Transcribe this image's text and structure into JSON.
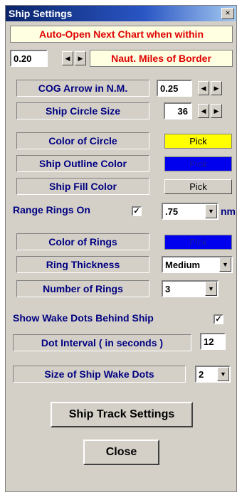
{
  "window": {
    "title": "Ship Settings",
    "close_glyph": "×"
  },
  "auto_open": {
    "label": "Auto-Open Next Chart when within",
    "value": "0.20",
    "unit_label": "Naut. Miles of Border"
  },
  "cog_arrow": {
    "label": "COG Arrow in N.M.",
    "value": "0.25"
  },
  "ship_circle_size": {
    "label": "Ship Circle Size",
    "value": "36"
  },
  "color_of_circle": {
    "label": "Color of Circle",
    "pick_label": "Pick",
    "color": "#ffff00"
  },
  "ship_outline_color": {
    "label": "Ship Outline Color",
    "pick_label": "Pick",
    "color": "#0000ee"
  },
  "ship_fill_color": {
    "label": "Ship Fill Color",
    "pick_label": "Pick",
    "color": "#d4d0c8"
  },
  "range_rings": {
    "label": "Range Rings On",
    "checked": true,
    "value": ".75",
    "unit": "nm"
  },
  "color_of_rings": {
    "label": "Color of Rings",
    "pick_label": "Pick",
    "color": "#0000ee"
  },
  "ring_thickness": {
    "label": "Ring Thickness",
    "value": "Medium"
  },
  "number_of_rings": {
    "label": "Number of Rings",
    "value": "3"
  },
  "wake_dots": {
    "label": "Show Wake Dots Behind Ship",
    "checked": true
  },
  "dot_interval": {
    "label": "Dot Interval  ( in seconds )",
    "value": "12"
  },
  "wake_dot_size": {
    "label": "Size of Ship Wake Dots",
    "value": "2"
  },
  "buttons": {
    "track_settings": "Ship Track Settings",
    "close": "Close"
  },
  "icons": {
    "spin_left": "◀",
    "spin_right": "▶",
    "dropdown": "▼",
    "check": "✓"
  }
}
